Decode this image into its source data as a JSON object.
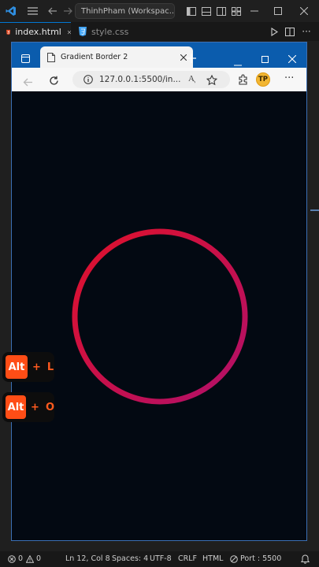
{
  "vscode": {
    "search_text": "ThinhPham (Workspac...",
    "tabs": [
      {
        "label": "index.html"
      },
      {
        "label": "style.css"
      }
    ]
  },
  "browser": {
    "tab_title": "Gradient Border 2",
    "url": "127.0.0.1:5500/in...",
    "profile_initials": "TP",
    "read_aloud_label": "A͉"
  },
  "page": {
    "ring_colors": {
      "start": "#e0112a",
      "end": "#b0106a"
    },
    "background": "#030912"
  },
  "key_hints": [
    {
      "modifier": "Alt",
      "plus": "+",
      "key": "L"
    },
    {
      "modifier": "Alt",
      "plus": "+",
      "key": "O"
    }
  ],
  "statusbar": {
    "errors": "0",
    "warnings": "0",
    "position": "Ln 12, Col 8",
    "spaces": "Spaces: 4",
    "encoding": "UTF-8",
    "eol": "CRLF",
    "language": "HTML",
    "port": "Port : 5500"
  },
  "colors": {
    "accent": "#0078d4",
    "browser_chrome": "#0b5cad",
    "keycap": "#ff4d16"
  }
}
